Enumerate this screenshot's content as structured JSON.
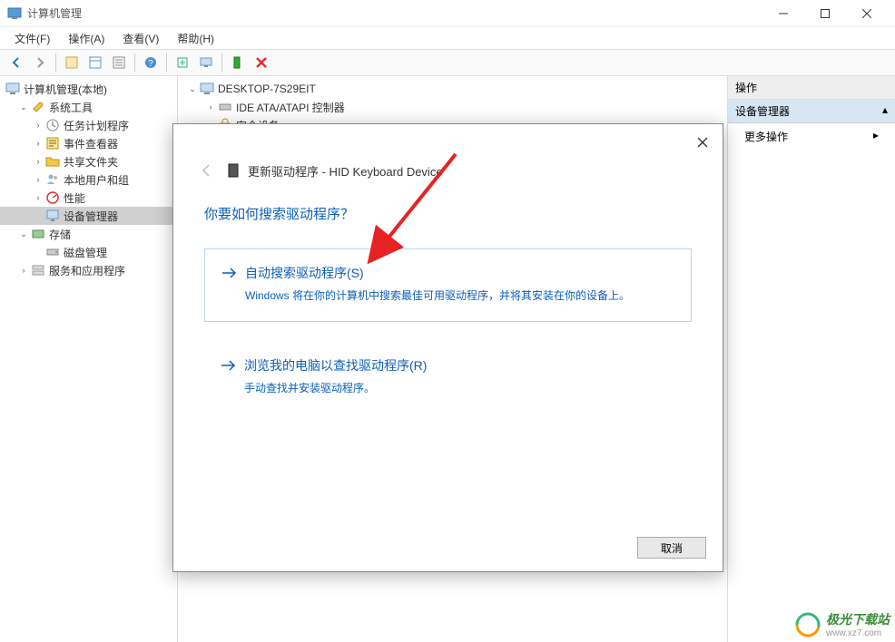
{
  "window": {
    "title": "计算机管理"
  },
  "menu": {
    "file": "文件(F)",
    "action": "操作(A)",
    "view": "查看(V)",
    "help": "帮助(H)"
  },
  "tree": {
    "root": "计算机管理(本地)",
    "system_tools": "系统工具",
    "task_scheduler": "任务计划程序",
    "event_viewer": "事件查看器",
    "shared_folders": "共享文件夹",
    "local_users": "本地用户和组",
    "performance": "性能",
    "device_manager": "设备管理器",
    "storage": "存储",
    "disk_mgmt": "磁盘管理",
    "services_apps": "服务和应用程序"
  },
  "devices": {
    "computer": "DESKTOP-7S29EIT",
    "ide": "IDE ATA/ATAPI 控制器",
    "security": "安全设备"
  },
  "actions": {
    "header": "操作",
    "device_manager": "设备管理器",
    "more": "更多操作"
  },
  "dialog": {
    "title": "更新驱动程序 - HID Keyboard Device",
    "question": "你要如何搜索驱动程序？",
    "opt1_title": "自动搜索驱动程序(S)",
    "opt1_desc": "Windows 将在你的计算机中搜索最佳可用驱动程序，并将其安装在你的设备上。",
    "opt2_title": "浏览我的电脑以查找驱动程序(R)",
    "opt2_desc": "手动查找并安装驱动程序。",
    "cancel": "取消"
  },
  "watermark": {
    "text": "极光下载站",
    "url": "www.xz7.com"
  }
}
